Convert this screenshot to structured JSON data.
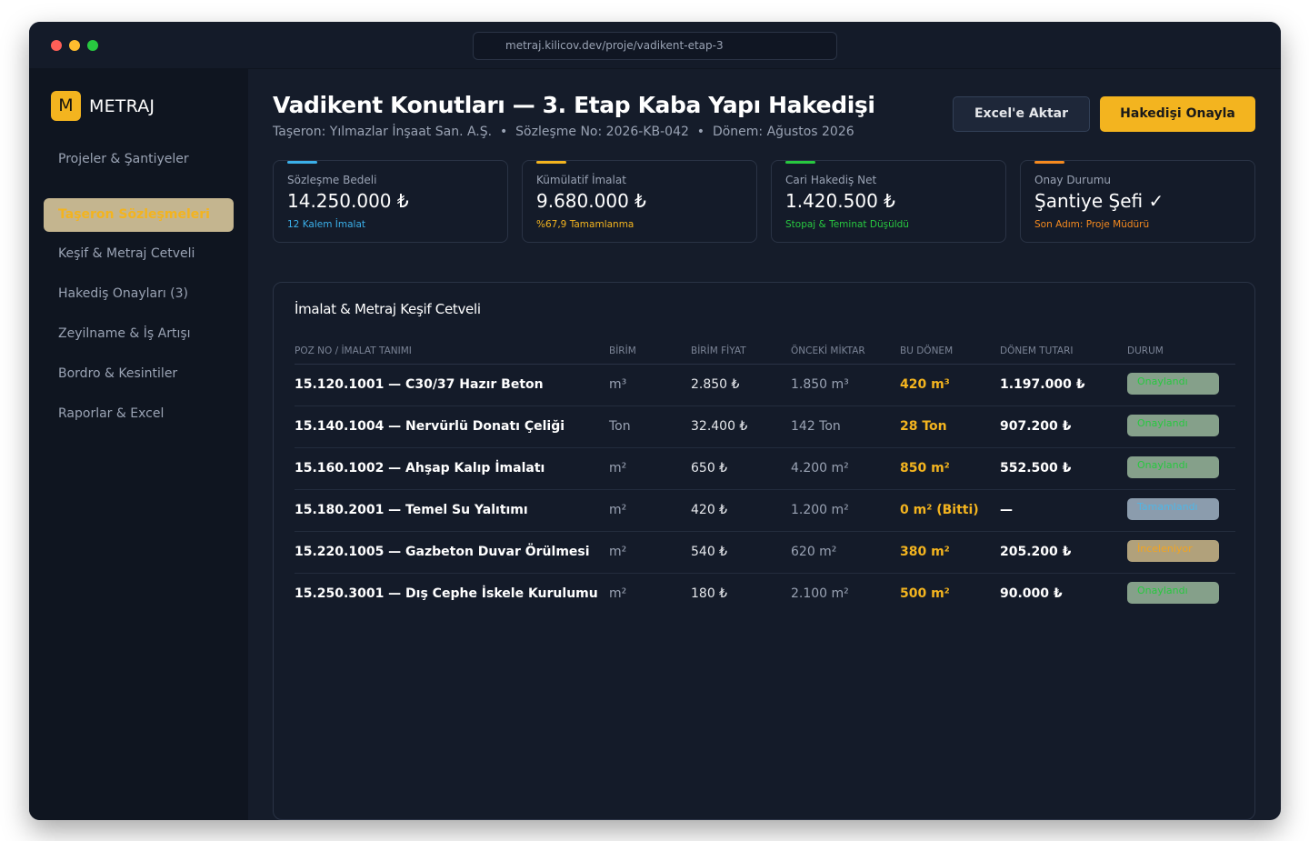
{
  "browser": {
    "url": "metraj.kilicov.dev/proje/vadikent-etap-3"
  },
  "sidebar": {
    "logo_letter": "M",
    "logo_text": "METRAJ",
    "items": [
      {
        "label": "Projeler & Şantiyeler",
        "active": false
      },
      {
        "label": "Taşeron Sözleşmeleri",
        "active": true
      },
      {
        "label": "Keşif & Metraj Cetveli",
        "active": false
      },
      {
        "label": "Hakediş Onayları (3)",
        "active": false
      },
      {
        "label": "Zeyilname & İş Artışı",
        "active": false
      },
      {
        "label": "Bordro & Kesintiler",
        "active": false
      },
      {
        "label": "Raporlar & Excel",
        "active": false
      }
    ]
  },
  "header": {
    "title": "Vadikent Konutları — 3. Etap Kaba Yapı Hakedişi",
    "subtitle": "Taşeron: Yılmazlar İnşaat San. A.Ş.  •  Sözleşme No: 2026-KB-042  •  Dönem: Ağustos 2026",
    "export_label": "Excel'e Aktar",
    "approve_label": "Hakedişi Onayla"
  },
  "cards": [
    {
      "label": "Sözleşme Bedeli",
      "value": "14.250.000 ₺",
      "note": "12 Kalem İmalat",
      "accent": "#3bb0ea",
      "note_color": "#3bb0ea"
    },
    {
      "label": "Kümülatif İmalat",
      "value": "9.680.000 ₺",
      "note": "%67,9 Tamamlanma",
      "accent": "#f3b41f",
      "note_color": "#f3b41f"
    },
    {
      "label": "Cari Hakediş Net",
      "value": "1.420.500 ₺",
      "note": "Stopaj & Teminat Düşüldü",
      "accent": "#28c840",
      "note_color": "#28c840"
    },
    {
      "label": "Onay Durumu",
      "value": "Şantiye Şefi ✓",
      "note": "Son Adım: Proje Müdürü",
      "accent": "#f58a1f",
      "note_color": "#f58a1f"
    }
  ],
  "table": {
    "title": "İmalat & Metraj Keşif Cetveli",
    "headers": [
      "POZ NO / İMALAT TANIMI",
      "BİRİM",
      "BİRİM FİYAT",
      "ÖNCEKİ MİKTAR",
      "BU DÖNEM",
      "DÖNEM TUTARI",
      "DURUM"
    ],
    "rows": [
      {
        "name": "15.120.1001 — C30/37 Hazır Beton",
        "unit": "m³",
        "price": "2.850 ₺",
        "prev": "1.850 m³",
        "current": "420 m³",
        "total": "1.197.000 ₺",
        "status": "Onaylandı",
        "status_type": "ok"
      },
      {
        "name": "15.140.1004 — Nervürlü Donatı Çeliği",
        "unit": "Ton",
        "price": "32.400 ₺",
        "prev": "142 Ton",
        "current": "28 Ton",
        "total": "907.200 ₺",
        "status": "Onaylandı",
        "status_type": "ok"
      },
      {
        "name": "15.160.1002 — Ahşap Kalıp İmalatı",
        "unit": "m²",
        "price": "650 ₺",
        "prev": "4.200 m²",
        "current": "850 m²",
        "total": "552.500 ₺",
        "status": "Onaylandı",
        "status_type": "ok"
      },
      {
        "name": "15.180.2001 — Temel Su Yalıtımı",
        "unit": "m²",
        "price": "420 ₺",
        "prev": "1.200 m²",
        "current": "0 m² (Bitti)",
        "total": "—",
        "status": "Tamamlandı",
        "status_type": "done"
      },
      {
        "name": "15.220.1005 — Gazbeton Duvar Örülmesi",
        "unit": "m²",
        "price": "540 ₺",
        "prev": "620 m²",
        "current": "380 m²",
        "total": "205.200 ₺",
        "status": "İnceleniyor",
        "status_type": "review"
      },
      {
        "name": "15.250.3001 — Dış Cephe İskele Kurulumu",
        "unit": "m²",
        "price": "180 ₺",
        "prev": "2.100 m²",
        "current": "500 m²",
        "total": "90.000 ₺",
        "status": "Onaylandı",
        "status_type": "ok"
      }
    ]
  }
}
